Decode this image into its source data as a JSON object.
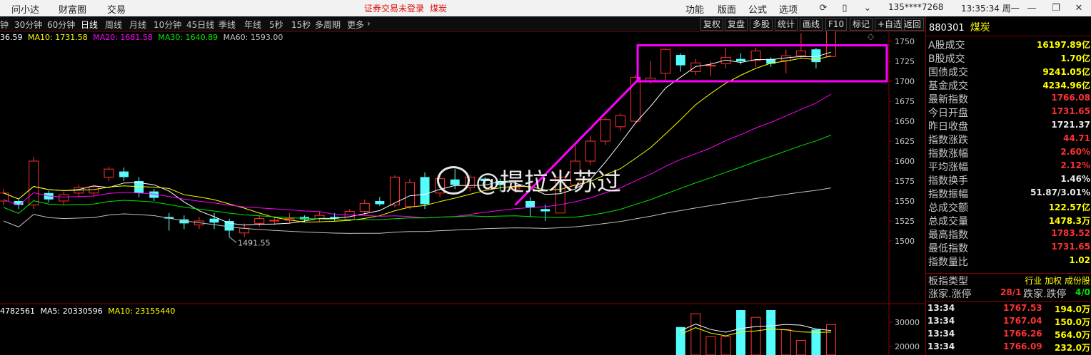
{
  "top_menu": {
    "left_items": [
      "问小达",
      "财富圈",
      "交易"
    ],
    "warning": "证券交易未登录",
    "stock_short": "煤炭",
    "right_items": [
      "功能",
      "版面",
      "公式",
      "选项"
    ],
    "phone": "135****7268",
    "time": "13:35:34 周一"
  },
  "timeframes": [
    "钟",
    "30分钟",
    "60分钟",
    "日线",
    "周线",
    "月线",
    "10分钟",
    "45日线",
    "季线",
    "年线",
    "5秒",
    "15秒",
    "多周期",
    "更多"
  ],
  "active_timeframe": "日线",
  "right_buttons": [
    "复权",
    "复盘",
    "多股",
    "统计",
    "画线",
    "F10",
    "标记",
    "+自选",
    "返回"
  ],
  "ma": {
    "ma5": "36.59",
    "ma10": "MA10: 1731.58",
    "ma20": "MA20: 1681.58",
    "ma30": "MA30: 1640.89",
    "ma60": "MA60: 1593.00"
  },
  "vol": {
    "vol": "4782561",
    "ma5": "MA5: 20330596",
    "ma10": "MA10: 23155440"
  },
  "colors": {
    "up": "#ff3232",
    "down": "#54fcfc",
    "ma5": "#ffffff",
    "ma10": "#ffff00",
    "ma20": "#ff00ff",
    "ma30": "#00e600",
    "ma60": "#c0c0c0",
    "annotation": "#ff00ff"
  },
  "annotations": {
    "high": "1783.52",
    "low": "1491.55"
  },
  "watermark": "@提拉米苏过",
  "chart_data": {
    "type": "candlestick",
    "price_ticks": [
      1750,
      1725,
      1700,
      1675,
      1650,
      1625,
      1600,
      1575,
      1550,
      1525,
      1500
    ],
    "volume_ticks": [
      30000,
      20000
    ],
    "candles": [
      [
        1550,
        1560,
        1545,
        1565
      ],
      [
        1550,
        1545,
        1540,
        1552
      ],
      [
        1545,
        1600,
        1540,
        1605
      ],
      [
        1560,
        1552,
        1548,
        1563
      ],
      [
        1550,
        1558,
        1545,
        1562
      ],
      [
        1560,
        1567,
        1555,
        1570
      ],
      [
        1560,
        1568,
        1555,
        1570
      ],
      [
        1580,
        1590,
        1575,
        1593
      ],
      [
        1587,
        1580,
        1575,
        1592
      ],
      [
        1575,
        1560,
        1555,
        1580
      ],
      [
        1562,
        1554,
        1550,
        1565
      ],
      [
        1530,
        1528,
        1513,
        1535
      ],
      [
        1527,
        1522,
        1515,
        1532
      ],
      [
        1520,
        1525,
        1515,
        1530
      ],
      [
        1528,
        1523,
        1515,
        1535
      ],
      [
        1525,
        1513,
        1505,
        1528
      ],
      [
        1510,
        1516,
        1505,
        1522
      ],
      [
        1522,
        1528,
        1518,
        1532
      ],
      [
        1525,
        1526,
        1520,
        1530
      ],
      [
        1526,
        1528,
        1522,
        1535
      ],
      [
        1530,
        1527,
        1524,
        1532
      ],
      [
        1528,
        1532,
        1524,
        1536
      ],
      [
        1530,
        1528,
        1525,
        1535
      ],
      [
        1527,
        1537,
        1525,
        1540
      ],
      [
        1537,
        1547,
        1532,
        1552
      ],
      [
        1550,
        1546,
        1544,
        1555
      ],
      [
        1545,
        1580,
        1542,
        1582
      ],
      [
        1543,
        1573,
        1540,
        1578
      ],
      [
        1580,
        1546,
        1540,
        1586
      ],
      [
        1560,
        1578,
        1555,
        1583
      ],
      [
        1577,
        1570,
        1565,
        1590
      ],
      [
        1567,
        1580,
        1562,
        1583
      ],
      [
        1578,
        1575,
        1570,
        1580
      ],
      [
        1575,
        1570,
        1562,
        1578
      ],
      [
        1565,
        1567,
        1560,
        1570
      ],
      [
        1550,
        1542,
        1530,
        1555
      ],
      [
        1540,
        1537,
        1525,
        1546
      ],
      [
        1535,
        1580,
        1535,
        1585
      ],
      [
        1570,
        1600,
        1565,
        1620
      ],
      [
        1600,
        1625,
        1595,
        1632
      ],
      [
        1625,
        1652,
        1620,
        1655
      ],
      [
        1643,
        1657,
        1638,
        1660
      ],
      [
        1650,
        1705,
        1648,
        1708
      ],
      [
        1700,
        1704,
        1697,
        1725
      ],
      [
        1710,
        1740,
        1700,
        1741
      ],
      [
        1733,
        1720,
        1712,
        1735
      ],
      [
        1712,
        1723,
        1708,
        1728
      ],
      [
        1720,
        1720,
        1706,
        1725
      ],
      [
        1722,
        1730,
        1716,
        1742
      ],
      [
        1728,
        1725,
        1721,
        1735
      ],
      [
        1726,
        1738,
        1718,
        1742
      ],
      [
        1728,
        1722,
        1718,
        1730
      ],
      [
        1726,
        1732,
        1710,
        1740
      ],
      [
        1732,
        1738,
        1728,
        1760
      ],
      [
        1740,
        1724,
        1716,
        1742
      ],
      [
        1731,
        1766,
        1731,
        1784
      ]
    ],
    "volumes": [
      28000,
      33500,
      24000,
      24000,
      35000,
      32000,
      35000,
      27000,
      22500,
      27000,
      29000
    ]
  },
  "panel": {
    "code": "880301",
    "name": "煤炭",
    "rows": [
      {
        "label": "A股成交",
        "value": "16197.89亿",
        "color": "#ffff00"
      },
      {
        "label": "B股成交",
        "value": "1.70亿",
        "color": "#ffff00"
      },
      {
        "label": "国债成交",
        "value": "9241.05亿",
        "color": "#ffff00"
      },
      {
        "label": "基金成交",
        "value": "4234.96亿",
        "color": "#ffff00"
      },
      {
        "label": "最新指数",
        "value": "1766.08",
        "color": "#ff3232"
      },
      {
        "label": "今日开盘",
        "value": "1731.65",
        "color": "#ff3232"
      },
      {
        "label": "昨日收盘",
        "value": "1721.37",
        "color": "#e8e8e8"
      },
      {
        "label": "指数涨跌",
        "value": "44.71",
        "color": "#ff3232"
      },
      {
        "label": "指数涨幅",
        "value": "2.60%",
        "color": "#ff3232"
      },
      {
        "label": "平均涨幅",
        "value": "2.12%",
        "color": "#ff3232"
      },
      {
        "label": "指数换手",
        "value": "1.46%",
        "color": "#e8e8e8"
      },
      {
        "label": "指数振幅",
        "value": "51.87/3.01%",
        "color": "#e8e8e8"
      },
      {
        "label": "总成交额",
        "value": "122.57亿",
        "color": "#ffff00"
      },
      {
        "label": "总成交量",
        "value": "1478.3万",
        "color": "#ffff00"
      },
      {
        "label": "最高指数",
        "value": "1783.52",
        "color": "#ff3232"
      },
      {
        "label": "最低指数",
        "value": "1731.65",
        "color": "#ff3232"
      },
      {
        "label": "指数量比",
        "value": "1.02",
        "color": "#ffff00"
      }
    ],
    "type_label": "板指类型",
    "type_value": "行业 加权 成份股",
    "rise_label": "涨家.涨停",
    "rise_value": "28/1",
    "fall_label": "跌家.跌停",
    "fall_value": "4/0",
    "ticks": [
      {
        "time": "13:34",
        "price": "1767.53",
        "vol": "194.0万"
      },
      {
        "time": "13:34",
        "price": "1767.04",
        "vol": "150.0万"
      },
      {
        "time": "13:34",
        "price": "1766.26",
        "vol": "564.0万"
      },
      {
        "time": "13:34",
        "price": "1766.09",
        "vol": "232.0万"
      }
    ]
  }
}
